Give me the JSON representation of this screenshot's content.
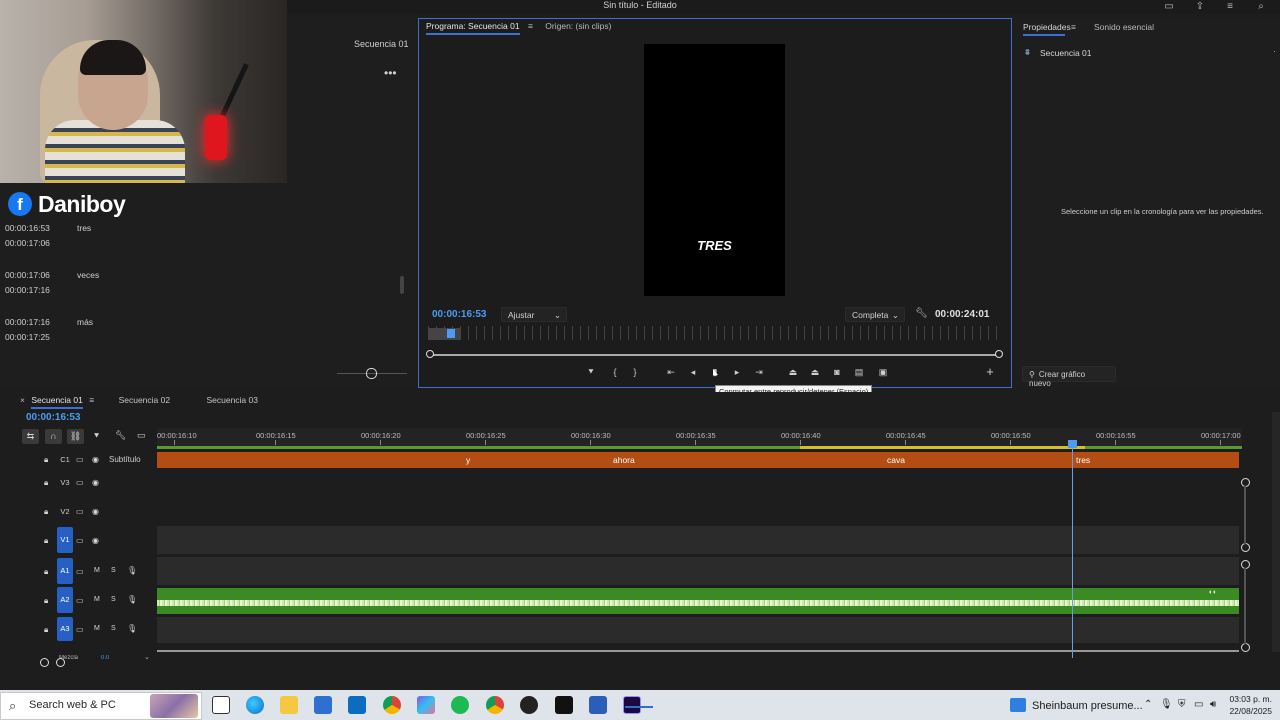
{
  "window": {
    "title": "Sin título - Editado"
  },
  "overlay": {
    "streamer": "Daniboy",
    "fb_icon": "f"
  },
  "left_panel": {
    "sequence": "Secuencia 01",
    "captions": [
      {
        "in": "00:00:16:53",
        "out": "00:00:17:06",
        "text": "tres"
      },
      {
        "in": "00:00:17:06",
        "out": "00:00:17:16",
        "text": "veces"
      },
      {
        "in": "00:00:17:16",
        "out": "00:00:17:25",
        "text": "más"
      }
    ]
  },
  "program": {
    "tab_active": "Programa: Secuencia 01",
    "tab_other": "Origen: (sin clips)",
    "caption": "TRES",
    "timecode": "00:00:16:53",
    "fit": "Ajustar",
    "quality": "Completa",
    "duration": "00:00:24:01",
    "tooltip": "Conmutar entre reproducir/detener (Espacio)"
  },
  "properties": {
    "tab_active": "Propiedades",
    "tab_other": "Sonido esencial",
    "sequence": "Secuencia 01",
    "message": "Seleccione un clip en la cronología para ver las propiedades.",
    "create_button": "Crear gráfico nuevo"
  },
  "timeline": {
    "tabs": [
      "Secuencia 01",
      "Secuencia 02",
      "Secuencia 03"
    ],
    "timecode": "00:00:16:53",
    "ruler": [
      "00:00:16:10",
      "00:00:16:15",
      "00:00:16:20",
      "00:00:16:25",
      "00:00:16:30",
      "00:00:16:35",
      "00:00:16:40",
      "00:00:16:45",
      "00:00:16:50",
      "00:00:16:55",
      "00:00:17:00"
    ],
    "subtitle_track": "Subtítulo",
    "subtitle_track_id": "C1",
    "subtitles": [
      "y",
      "ahora",
      "cava",
      "tres"
    ],
    "video_tracks": [
      "V3",
      "V2",
      "V1"
    ],
    "audio_tracks": [
      "A1",
      "A2",
      "A3"
    ],
    "mute": "M",
    "solo": "S",
    "master": "Mezcla",
    "master_value": "0.0"
  },
  "taskbar": {
    "search": "Search web & PC",
    "news": "Sheinbaum presume...",
    "time": "03:03 p. m.",
    "date": "22/08/2025"
  }
}
